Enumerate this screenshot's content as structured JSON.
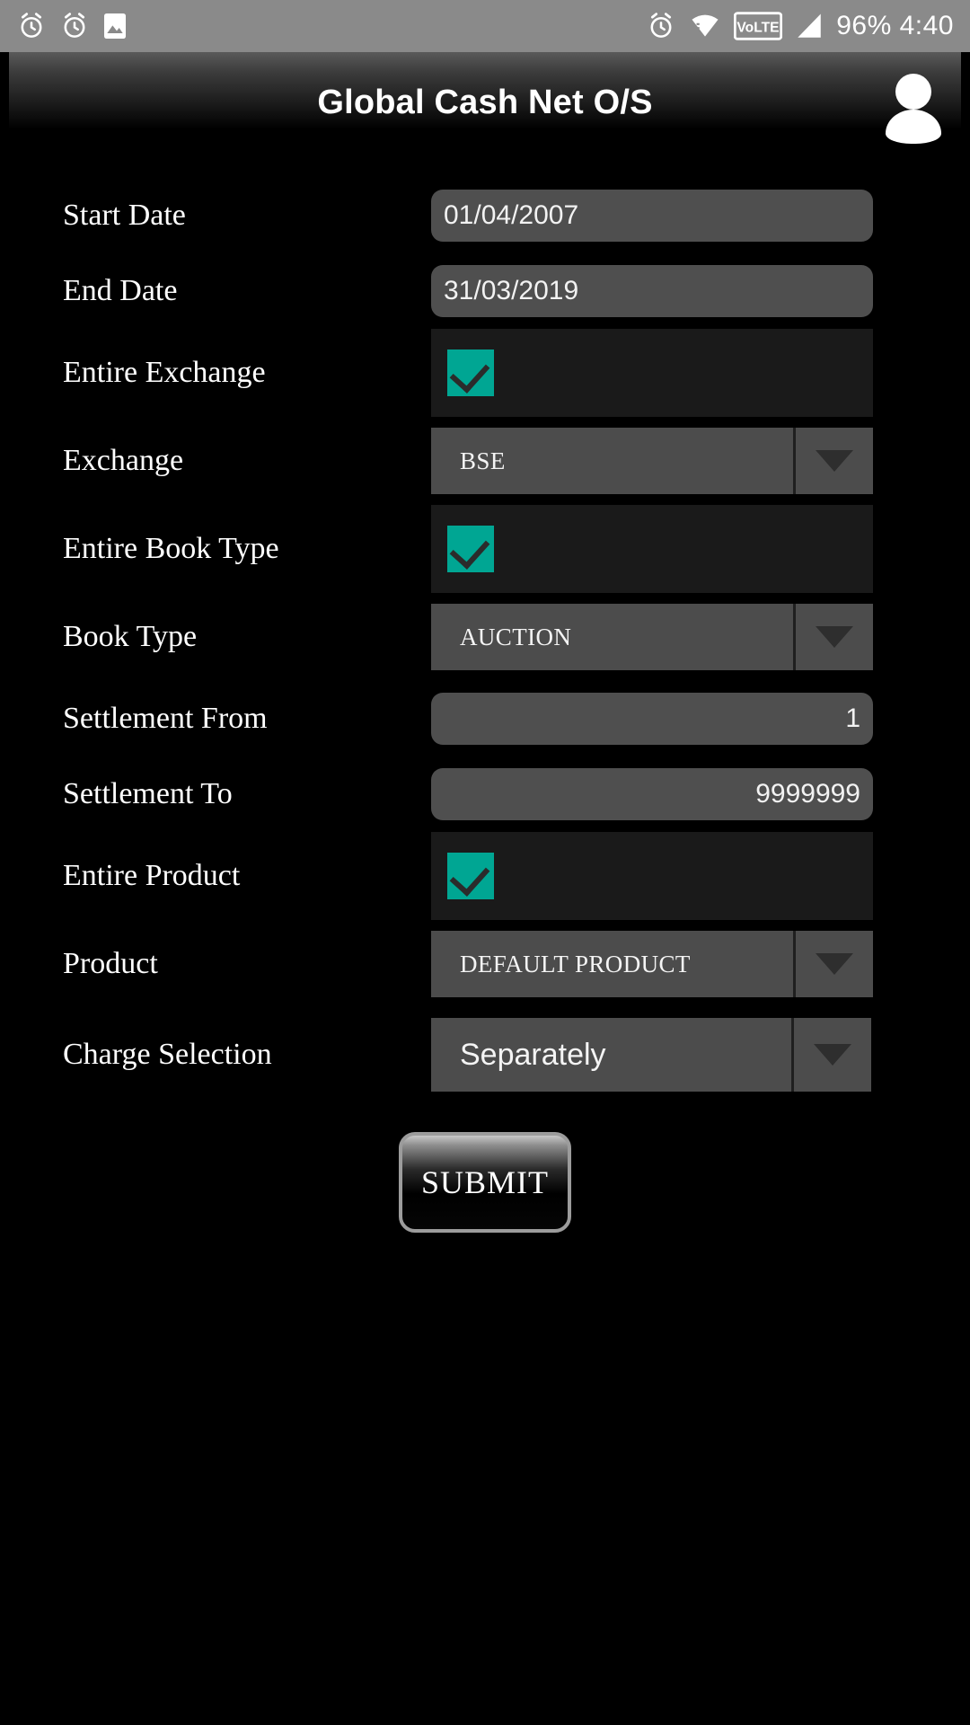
{
  "status_bar": {
    "left_icons": [
      "alarm-clock-icon",
      "alarm-clock-icon",
      "image-icon"
    ],
    "right_icons": [
      "alarm-clock-icon",
      "wifi-icon",
      "volte-icon",
      "signal-icon"
    ],
    "volte_label": "VoLTE",
    "battery": "96%",
    "time": "4:40",
    "battery_and_time": "96% 4:40"
  },
  "title_bar": {
    "title": "Global Cash Net O/S",
    "avatar_icon": "person-icon"
  },
  "form": {
    "rows": [
      {
        "label": "Start Date",
        "type": "input",
        "value": "01/04/2007",
        "align": "left"
      },
      {
        "label": "End Date",
        "type": "input",
        "value": "31/03/2019",
        "align": "left"
      },
      {
        "label": "Entire Exchange",
        "type": "checkbox",
        "checked": true
      },
      {
        "label": "Exchange",
        "type": "spinner",
        "value": "BSE",
        "font": "serif"
      },
      {
        "label": "Entire Book Type",
        "type": "checkbox",
        "checked": true
      },
      {
        "label": "Book Type",
        "type": "spinner",
        "value": "AUCTION",
        "font": "serif"
      },
      {
        "label": "Settlement From",
        "type": "input",
        "value": "1",
        "align": "right"
      },
      {
        "label": "Settlement To",
        "type": "input",
        "value": "9999999",
        "align": "right"
      },
      {
        "label": "Entire Product",
        "type": "checkbox",
        "checked": true
      },
      {
        "label": "Product",
        "type": "spinner",
        "value": "DEFAULT PRODUCT",
        "font": "serif"
      },
      {
        "label": "Charge Selection",
        "type": "spinner",
        "value": "Separately",
        "font": "sans"
      }
    ]
  },
  "submit": {
    "label": "SUBMIT"
  },
  "colors": {
    "accent_teal": "#00a693",
    "status_bar_bg": "#8a8a8a",
    "field_bg": "#4f4f4f",
    "spinner_bg": "#4c4c4c",
    "page_bg": "#000000"
  }
}
